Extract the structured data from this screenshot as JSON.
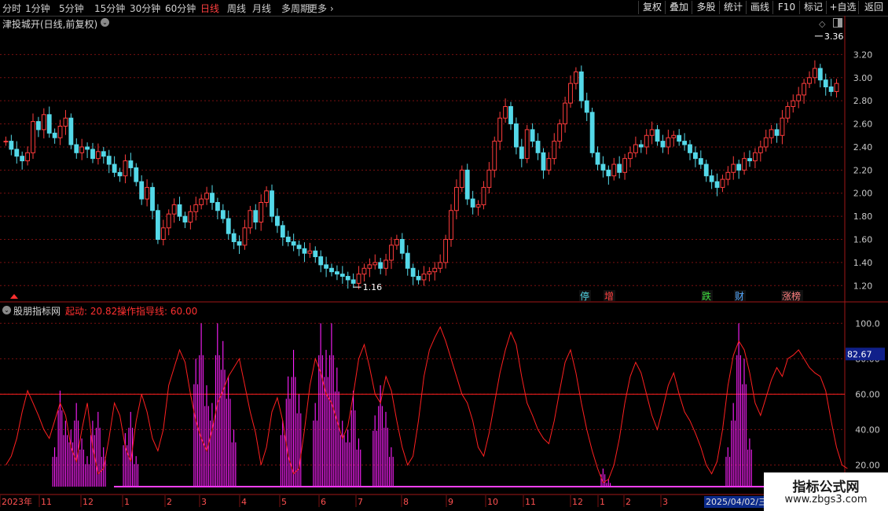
{
  "toolbar": {
    "periods": [
      "分时",
      "1分钟",
      "5分钟",
      "15分钟",
      "30分钟",
      "60分钟",
      "日线",
      "周线",
      "月线",
      "多周期",
      "更多"
    ],
    "active_period": "日线",
    "right_buttons": [
      "复权",
      "叠加",
      "多股",
      "统计",
      "画线",
      "F10",
      "标记",
      "+自选",
      "返回"
    ]
  },
  "stock": {
    "title": "津投城开(日线,前复权)"
  },
  "indicator": {
    "name": "股朋指标网",
    "start_label": "起动: 20.82",
    "guide_label": "操作指导线: 60.00",
    "current_value": "82.67"
  },
  "watermark": {
    "cn": "指标公式网",
    "url": "www.zbgs3.com"
  },
  "cursor_date": "2025/04/02/三",
  "colors": {
    "up": "#ff3c3c",
    "down": "#54d8e8",
    "grid": "#7a1010",
    "indicator_line": "#ff2020",
    "bars": "#ff20ff",
    "guide_line": "#ff2020",
    "axis_text": "#c8c8c8"
  },
  "chart_data": [
    {
      "type": "candlestick",
      "ylim": [
        1.1,
        3.4
      ],
      "y_ticks": [
        "3.20",
        "3.00",
        "2.80",
        "2.60",
        "2.40",
        "2.20",
        "2.00",
        "1.80",
        "1.60",
        "1.40",
        "1.20"
      ],
      "high_marker": "3.36",
      "low_marker": "1.16",
      "event_labels": [
        {
          "text": "停",
          "color": "#54d8e8"
        },
        {
          "text": "增",
          "color": "#ff4040"
        },
        {
          "text": "跌",
          "color": "#40e040"
        },
        {
          "text": "财",
          "color": "#54a8ff"
        },
        {
          "text": "涨榜",
          "color": "#ff8080"
        }
      ],
      "closes": [
        2.45,
        2.38,
        2.32,
        2.28,
        2.35,
        2.62,
        2.55,
        2.68,
        2.52,
        2.48,
        2.58,
        2.65,
        2.42,
        2.35,
        2.4,
        2.38,
        2.3,
        2.36,
        2.32,
        2.25,
        2.18,
        2.15,
        2.28,
        2.22,
        2.1,
        1.95,
        2.05,
        1.85,
        1.6,
        1.7,
        1.82,
        1.9,
        1.8,
        1.75,
        1.84,
        1.9,
        1.95,
        2.0,
        1.92,
        1.85,
        1.78,
        1.65,
        1.58,
        1.55,
        1.7,
        1.85,
        1.75,
        1.92,
        2.02,
        1.8,
        1.72,
        1.62,
        1.58,
        1.55,
        1.52,
        1.48,
        1.5,
        1.45,
        1.38,
        1.35,
        1.32,
        1.3,
        1.28,
        1.25,
        1.22,
        1.3,
        1.35,
        1.38,
        1.4,
        1.35,
        1.42,
        1.55,
        1.6,
        1.48,
        1.35,
        1.28,
        1.25,
        1.3,
        1.32,
        1.35,
        1.4,
        1.6,
        1.85,
        2.05,
        2.2,
        1.95,
        1.88,
        1.9,
        2.05,
        2.2,
        2.45,
        2.65,
        2.75,
        2.6,
        2.4,
        2.3,
        2.55,
        2.45,
        2.35,
        2.2,
        2.3,
        2.45,
        2.6,
        2.78,
        2.95,
        3.05,
        2.8,
        2.7,
        2.35,
        2.25,
        2.2,
        2.15,
        2.25,
        2.18,
        2.3,
        2.35,
        2.42,
        2.4,
        2.5,
        2.55,
        2.45,
        2.4,
        2.48,
        2.5,
        2.45,
        2.42,
        2.35,
        2.3,
        2.25,
        2.15,
        2.1,
        2.05,
        2.12,
        2.18,
        2.25,
        2.2,
        2.3,
        2.28,
        2.35,
        2.4,
        2.48,
        2.55,
        2.5,
        2.65,
        2.75,
        2.8,
        2.85,
        2.95,
        3.0,
        3.08,
        2.98,
        2.92,
        2.88,
        2.95
      ],
      "x_tick_labels": [
        "2023年",
        "11",
        "12",
        "1",
        "2",
        "3",
        "4",
        "5",
        "6",
        "7",
        "8",
        "9",
        "10",
        "11",
        "12",
        "1",
        "2",
        "3"
      ]
    },
    {
      "type": "line+bar",
      "ylim": [
        10,
        105
      ],
      "y_ticks": [
        "100.0",
        "80.00",
        "60.00",
        "40.00",
        "20.00"
      ],
      "guide_value": 60,
      "start_value": 20.82,
      "current_value": 82.67,
      "line_values": [
        20,
        25,
        35,
        50,
        62,
        55,
        48,
        40,
        35,
        45,
        55,
        48,
        30,
        22,
        40,
        55,
        30,
        15,
        18,
        35,
        55,
        48,
        30,
        22,
        45,
        60,
        50,
        35,
        28,
        40,
        65,
        75,
        85,
        78,
        60,
        45,
        35,
        28,
        40,
        55,
        62,
        70,
        75,
        80,
        65,
        50,
        38,
        20,
        30,
        50,
        58,
        45,
        25,
        15,
        18,
        40,
        65,
        80,
        72,
        60,
        55,
        45,
        35,
        42,
        60,
        80,
        88,
        75,
        60,
        55,
        70,
        62,
        45,
        30,
        20,
        25,
        45,
        70,
        85,
        92,
        98,
        90,
        80,
        70,
        60,
        55,
        45,
        30,
        25,
        38,
        55,
        72,
        85,
        95,
        88,
        70,
        55,
        48,
        40,
        35,
        32,
        45,
        62,
        78,
        85,
        72,
        55,
        40,
        28,
        18,
        10,
        12,
        20,
        35,
        55,
        70,
        78,
        72,
        60,
        48,
        40,
        52,
        65,
        72,
        60,
        50,
        45,
        38,
        30,
        20,
        15,
        22,
        40,
        65,
        82,
        90,
        85,
        72,
        55,
        48,
        58,
        68,
        75,
        70,
        80,
        82,
        85,
        80,
        75,
        72,
        70,
        62,
        45,
        30,
        20,
        18
      ],
      "bar_groups": [
        {
          "days": [
            9,
            10,
            11
          ],
          "values": [
            30,
            62,
            45
          ]
        },
        {
          "days": [
            12,
            13,
            14
          ],
          "values": [
            40,
            55,
            35
          ]
        },
        {
          "days": [
            15,
            16,
            17,
            18
          ],
          "values": [
            25,
            45,
            50,
            30
          ]
        },
        {
          "days": [
            22,
            23,
            24
          ],
          "values": [
            38,
            50,
            25
          ]
        },
        {
          "days": [
            35,
            36,
            37
          ],
          "values": [
            80,
            100,
            65
          ]
        },
        {
          "days": [
            38,
            39,
            40,
            41,
            42
          ],
          "values": [
            55,
            100,
            90,
            70,
            40
          ]
        },
        {
          "days": [
            51,
            52,
            53,
            54
          ],
          "values": [
            45,
            70,
            85,
            60
          ]
        },
        {
          "days": [
            57,
            58,
            59,
            60,
            61,
            62
          ],
          "values": [
            55,
            100,
            85,
            100,
            75,
            45
          ]
        },
        {
          "days": [
            63,
            64,
            65
          ],
          "values": [
            40,
            62,
            35
          ]
        },
        {
          "days": [
            68,
            69,
            70,
            71
          ],
          "values": [
            48,
            65,
            50,
            30
          ]
        },
        {
          "days": [
            110,
            111,
            112
          ],
          "values": [
            18,
            12,
            8
          ]
        },
        {
          "days": [
            133,
            134,
            135,
            136,
            137
          ],
          "values": [
            30,
            55,
            100,
            80,
            35
          ]
        }
      ]
    }
  ]
}
